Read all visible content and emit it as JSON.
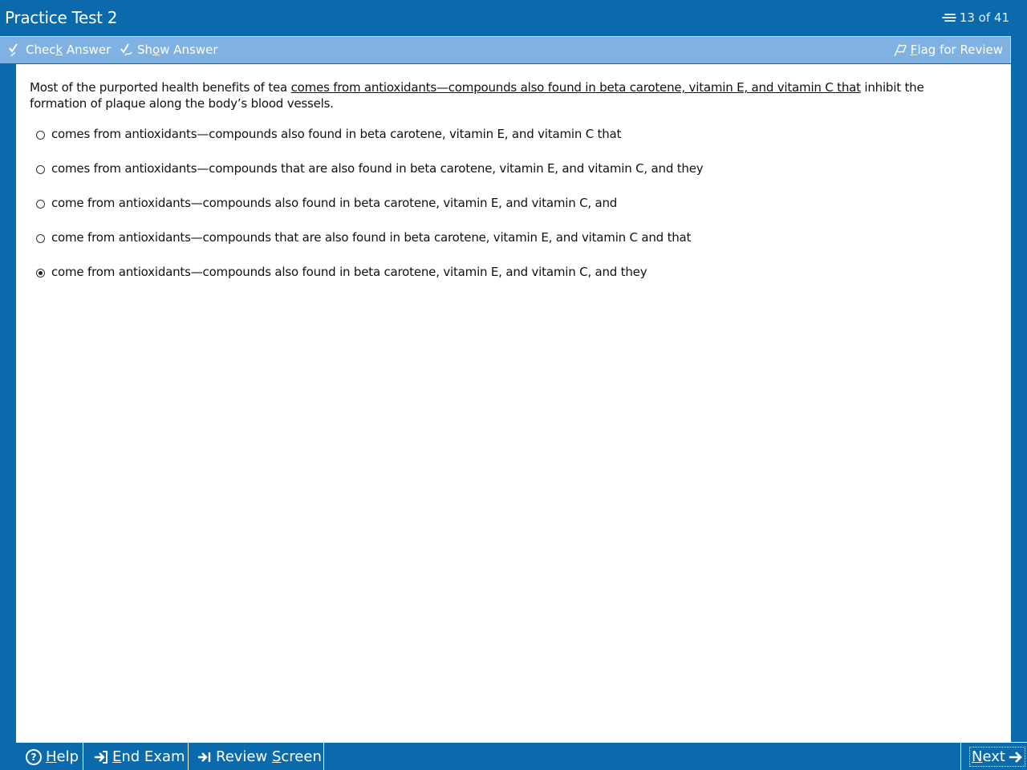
{
  "window": {
    "title": "Practice Test 2",
    "counter_icon": "list-icon",
    "counter": "13 of 41"
  },
  "toolbar": {
    "check_answer_icon": "check-answer-icon",
    "check_answer": {
      "pre": "Chec",
      "u": "k",
      "post": " Answer"
    },
    "show_answer_icon": "show-answer-icon",
    "show_answer": {
      "pre": "Sh",
      "u": "o",
      "post": "w Answer"
    },
    "flag_icon": "flag-icon",
    "flag_review": {
      "pre": "",
      "u": "F",
      "post": "lag for Review"
    }
  },
  "question": {
    "prefix": "Most of the purported health benefits of tea ",
    "underlined": "comes from antioxidants—compounds also found in beta carotene, vitamin E, and vitamin C that",
    "suffix": " inhibit the formation of plaque along the body’s blood vessels."
  },
  "options": [
    {
      "text": "comes from antioxidants—compounds also found in beta carotene, vitamin E, and vitamin C that",
      "selected": false
    },
    {
      "text": "comes from antioxidants—compounds that are also found in beta carotene, vitamin E, and vitamin C, and they",
      "selected": false
    },
    {
      "text": "come from antioxidants—compounds also found in beta carotene, vitamin E, and vitamin C, and",
      "selected": false
    },
    {
      "text": "come from antioxidants—compounds that are also found in beta carotene, vitamin E, and vitamin C and that",
      "selected": false
    },
    {
      "text": "come from antioxidants—compounds also found in beta carotene, vitamin E, and vitamin C, and they",
      "selected": true
    }
  ],
  "bottom": {
    "help_icon": "help-icon",
    "help": {
      "pre": "",
      "u": "H",
      "post": "elp"
    },
    "end_exam_icon": "end-exam-icon",
    "end_exam": {
      "pre": "",
      "u": "E",
      "post": "nd Exam"
    },
    "review_icon": "review-screen-icon",
    "review_screen": {
      "pre": "Review ",
      "u": "S",
      "post": "creen"
    },
    "next": {
      "pre": "",
      "u": "N",
      "post": "ext"
    },
    "next_icon": "next-arrow-icon"
  },
  "colors": {
    "background": "#0a6aab",
    "toolbar": "#7fb1e3",
    "content": "#ffffff"
  }
}
